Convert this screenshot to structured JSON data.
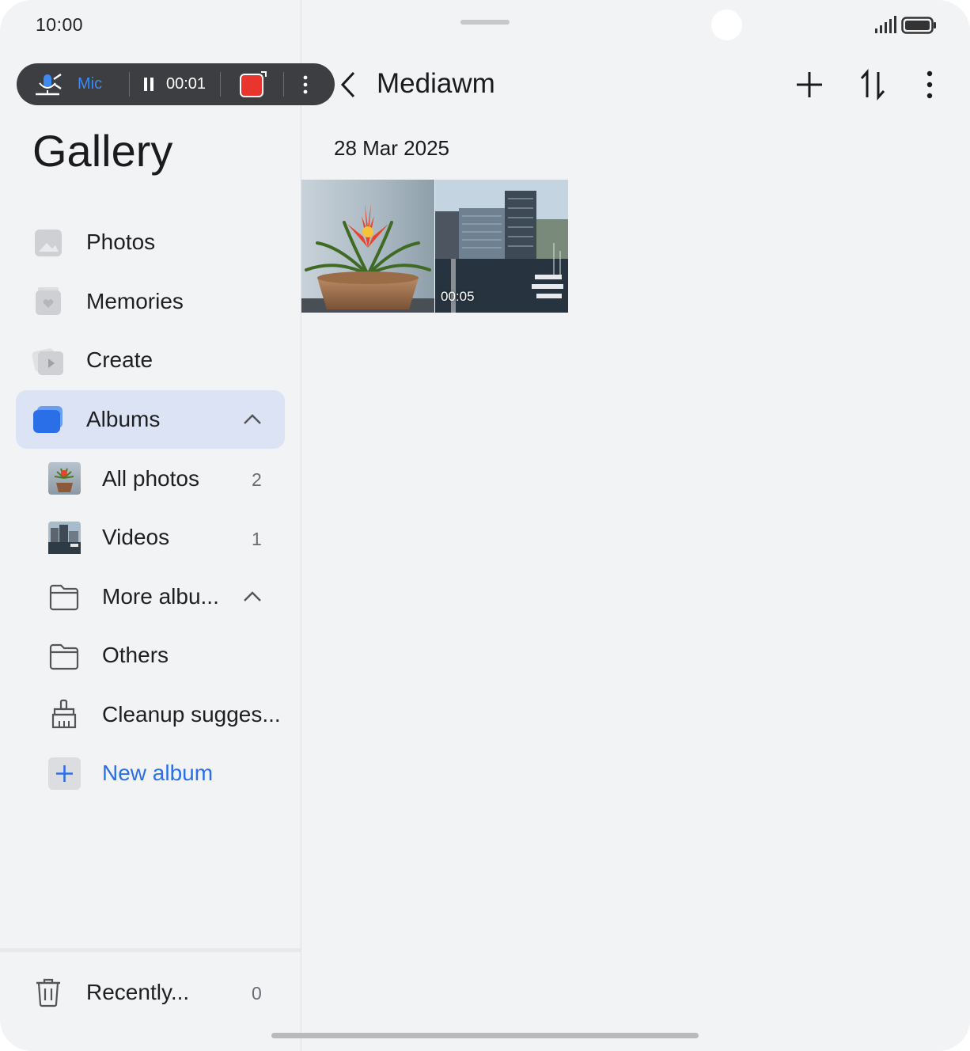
{
  "status_bar": {
    "time": "10:00"
  },
  "recorder": {
    "mic_label": "Mic",
    "elapsed": "00:01"
  },
  "sidebar": {
    "title": "Gallery",
    "items": [
      {
        "label": "Photos"
      },
      {
        "label": "Memories"
      },
      {
        "label": "Create"
      },
      {
        "label": "Albums"
      }
    ],
    "albums": [
      {
        "label": "All photos",
        "count": "2"
      },
      {
        "label": "Videos",
        "count": "1"
      },
      {
        "label": "More albu..."
      },
      {
        "label": "Others"
      },
      {
        "label": "Cleanup sugges..."
      },
      {
        "label": "New album"
      }
    ],
    "recently_deleted": {
      "label": "Recently...",
      "count": "0"
    }
  },
  "header": {
    "title": "Mediawm"
  },
  "content": {
    "date": "28 Mar 2025",
    "thumbnails": [
      {
        "kind": "photo"
      },
      {
        "kind": "video",
        "duration": "00:05"
      }
    ]
  },
  "colors": {
    "accent": "#2b6fe8",
    "highlight": "#dbe3f5",
    "background": "#f2f3f5"
  }
}
